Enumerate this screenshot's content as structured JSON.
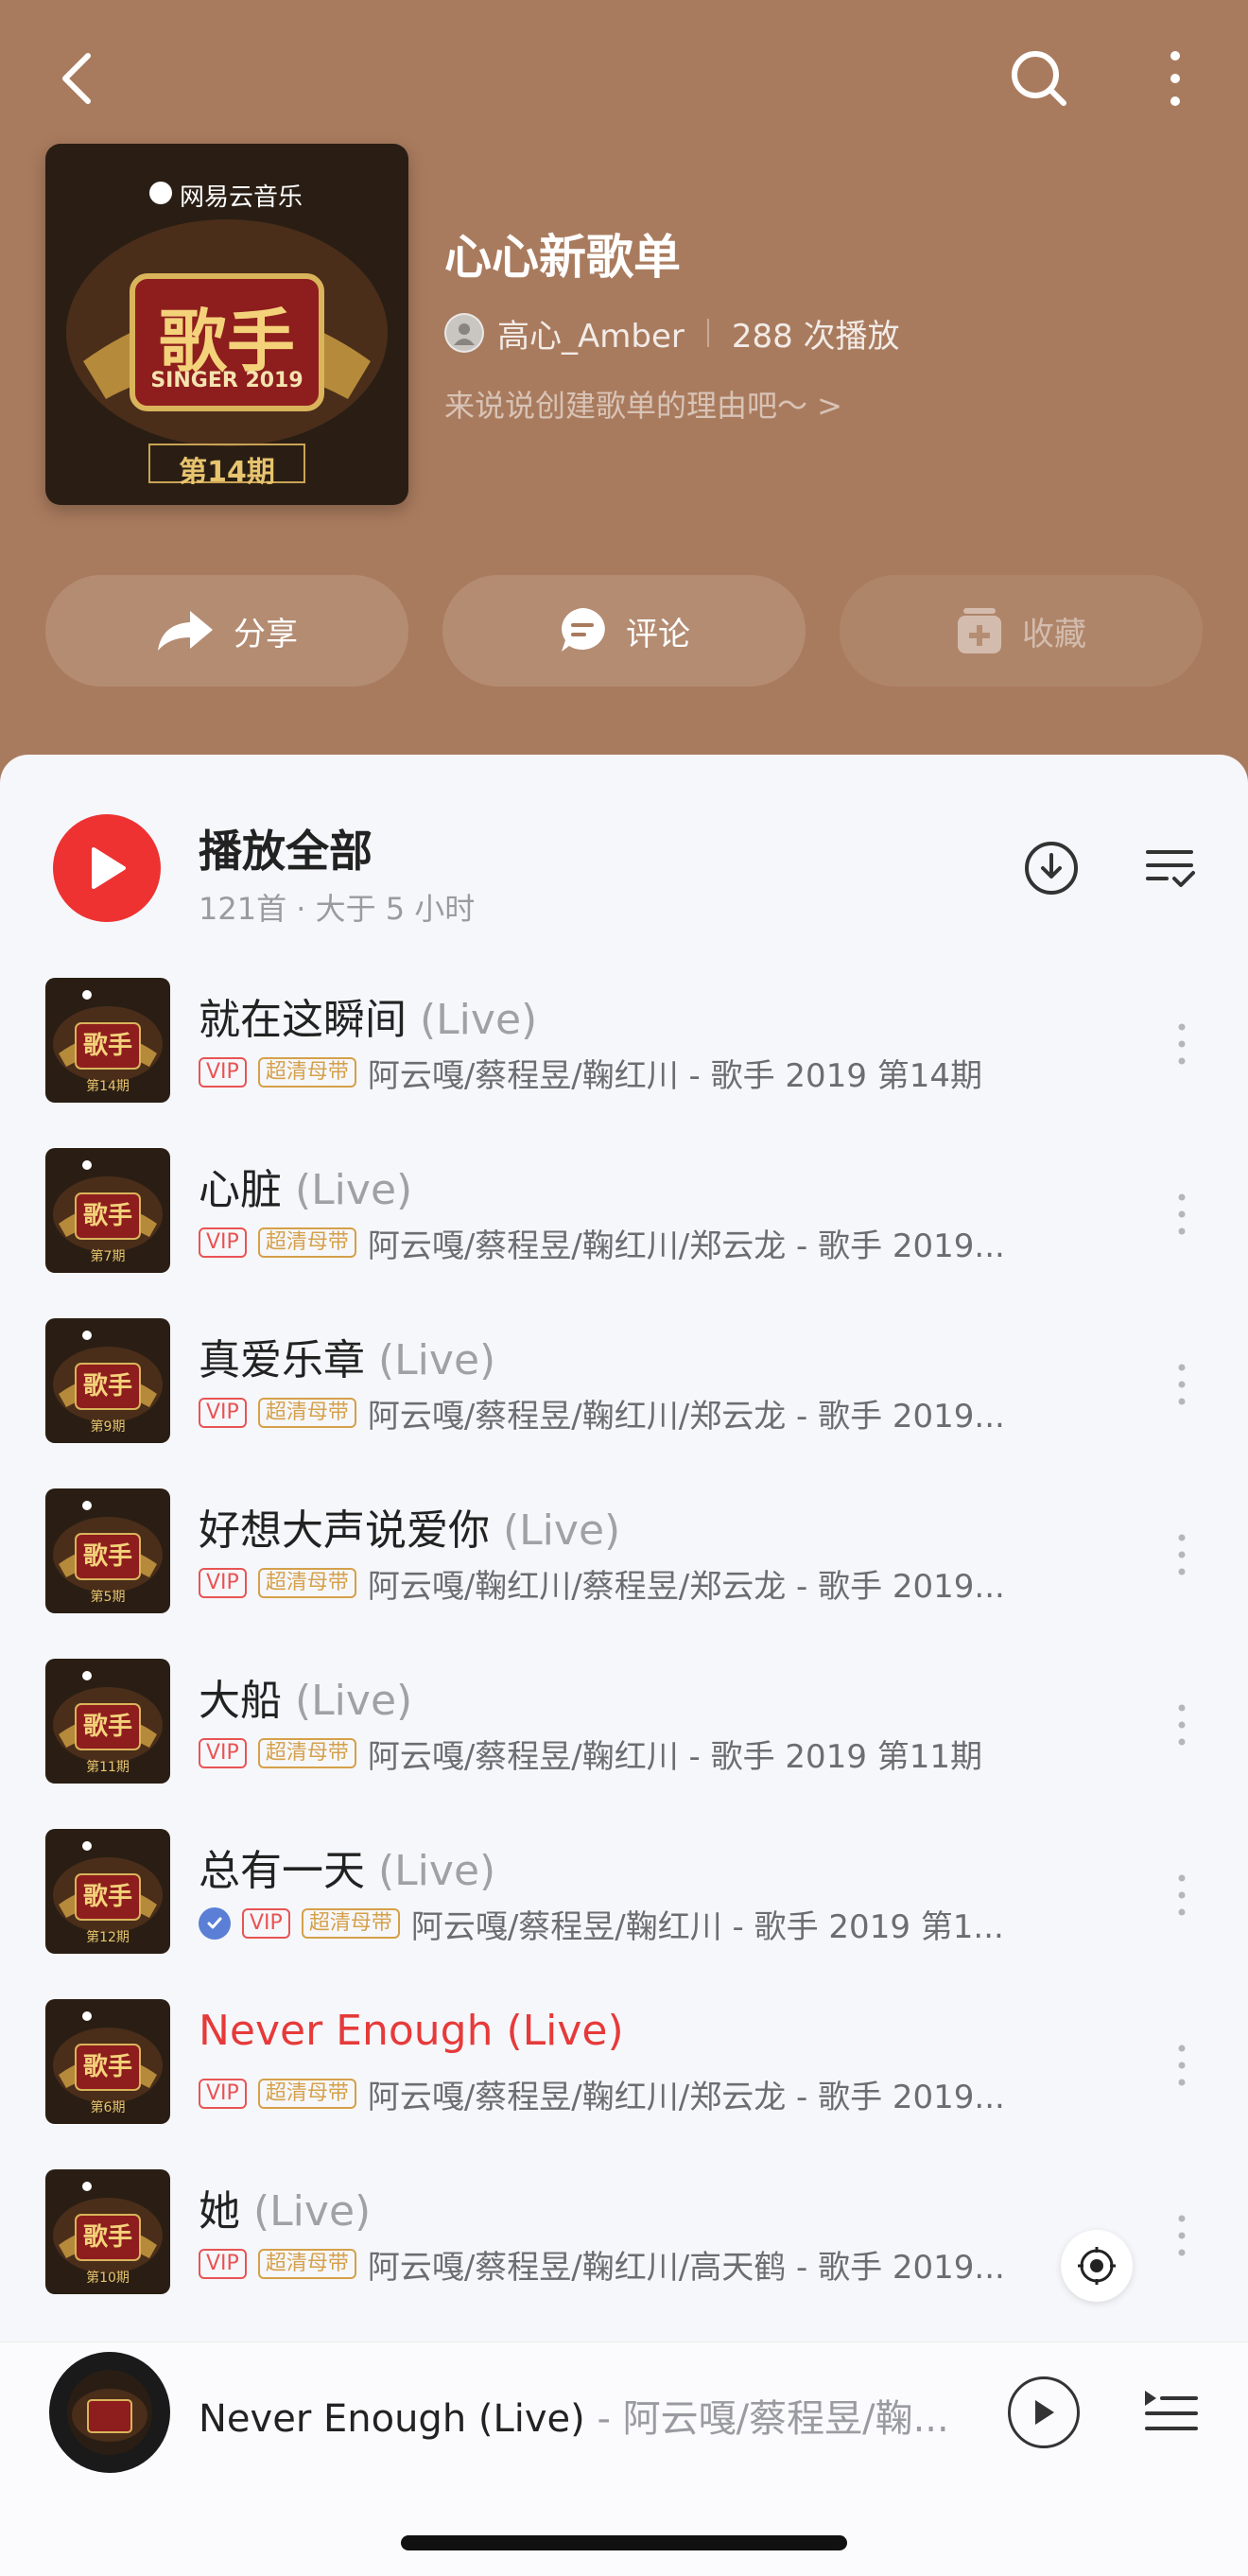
{
  "header": {
    "cover_brand": "网易云音乐",
    "cover_title": "歌手",
    "cover_subtitle": "SINGER 2019",
    "cover_issue": "第14期",
    "playlist_title": "心心新歌单",
    "creator_name": "高心_Amber",
    "play_count": "288 次播放",
    "description_prompt": "来说说创建歌单的理由吧～ >",
    "colors": {
      "background": "#a97b5e"
    }
  },
  "actions": {
    "share_label": "分享",
    "comment_label": "评论",
    "collect_label": "收藏"
  },
  "play_all": {
    "label": "播放全部",
    "subtitle": "121首 · 大于 5 小时"
  },
  "tags": {
    "vip": "VIP",
    "hq": "超清母带"
  },
  "songs": [
    {
      "title": "就在这瞬间",
      "suffix": "(Live)",
      "artists": "阿云嘎/蔡程昱/鞠红川 - 歌手 2019 第14期",
      "issue": "第14期",
      "playing": false,
      "verified": false
    },
    {
      "title": "心脏",
      "suffix": "(Live)",
      "artists": "阿云嘎/蔡程昱/鞠红川/郑云龙 - 歌手 2019...",
      "issue": "第7期",
      "playing": false,
      "verified": false
    },
    {
      "title": "真爱乐章",
      "suffix": "(Live)",
      "artists": "阿云嘎/蔡程昱/鞠红川/郑云龙 - 歌手 2019...",
      "issue": "第9期",
      "playing": false,
      "verified": false
    },
    {
      "title": "好想大声说爱你",
      "suffix": "(Live)",
      "artists": "阿云嘎/鞠红川/蔡程昱/郑云龙 - 歌手 2019...",
      "issue": "第5期",
      "playing": false,
      "verified": false
    },
    {
      "title": "大船",
      "suffix": "(Live)",
      "artists": "阿云嘎/蔡程昱/鞠红川 - 歌手 2019 第11期",
      "issue": "第11期",
      "playing": false,
      "verified": false
    },
    {
      "title": "总有一天",
      "suffix": "(Live)",
      "artists": "阿云嘎/蔡程昱/鞠红川 - 歌手 2019 第1...",
      "issue": "第12期",
      "playing": false,
      "verified": true
    },
    {
      "title": "Never Enough",
      "suffix": "(Live)",
      "artists": "阿云嘎/蔡程昱/鞠红川/郑云龙 - 歌手 2019...",
      "issue": "第6期",
      "playing": true,
      "verified": false
    },
    {
      "title": "她",
      "suffix": "(Live)",
      "artists": "阿云嘎/蔡程昱/鞠红川/高天鹤 - 歌手 2019...",
      "issue": "第10期",
      "playing": false,
      "verified": false
    }
  ],
  "mini_player": {
    "title": "Never Enough (Live)",
    "artist_part": " - 阿云嘎/蔡程昱/鞠..."
  },
  "icons": {
    "back": "back-arrow-icon",
    "search": "search-icon",
    "more": "more-vertical-icon",
    "share": "share-arrow-icon",
    "comment": "comment-bubble-icon",
    "collect": "collect-plus-icon",
    "download": "download-icon",
    "multiselect": "multiselect-list-icon",
    "locate": "locate-target-icon",
    "queue": "playlist-queue-icon"
  },
  "colors": {
    "accent_red": "#ee3232",
    "playing_text": "#e63a3a",
    "vip_tag": "#e85454",
    "hq_tag": "#d5a04a"
  }
}
